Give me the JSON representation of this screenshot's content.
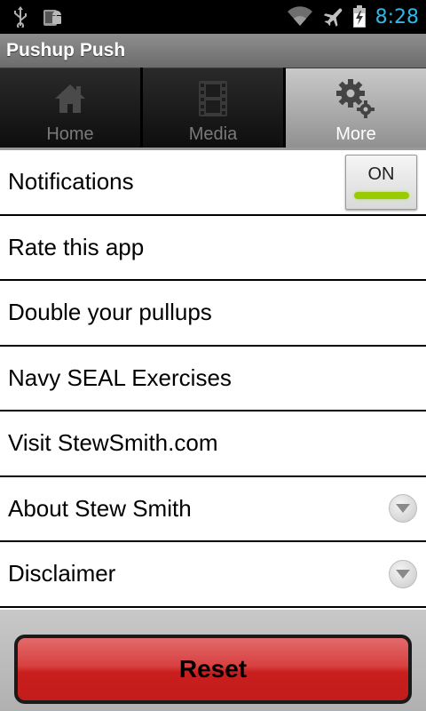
{
  "status_bar": {
    "time": "8:28",
    "left_icons": [
      "usb-icon",
      "android-debug-icon"
    ],
    "right_icons": [
      "wifi-icon",
      "airplane-icon",
      "battery-icon"
    ],
    "time_color": "#33b5e5"
  },
  "app": {
    "title": "Pushup Push"
  },
  "tabs": [
    {
      "label": "Home",
      "icon": "home-icon",
      "active": false
    },
    {
      "label": "Media",
      "icon": "film-icon",
      "active": false
    },
    {
      "label": "More",
      "icon": "gear-icon",
      "active": true
    }
  ],
  "list": {
    "notifications": {
      "label": "Notifications",
      "toggle_text": "ON",
      "toggle_on": true,
      "accent": "#99cc00"
    },
    "items": [
      {
        "label": "Rate this app"
      },
      {
        "label": "Double your pullups"
      },
      {
        "label": "Navy SEAL Exercises"
      },
      {
        "label": "Visit StewSmith.com"
      },
      {
        "label": "About Stew Smith",
        "expandable": true
      },
      {
        "label": "Disclaimer",
        "expandable": true
      }
    ]
  },
  "footer": {
    "reset_label": "Reset",
    "reset_color": "#d32f2f"
  }
}
